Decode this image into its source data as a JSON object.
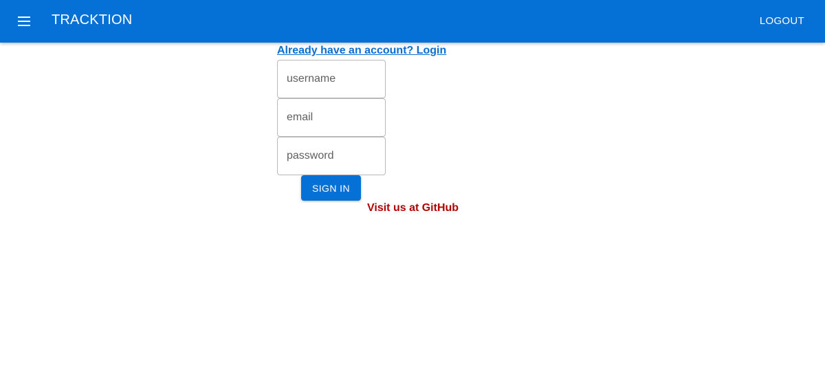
{
  "header": {
    "menu_icon": "hamburger-menu-icon",
    "title": "TRACKTION",
    "logout_label": "LOGOUT",
    "bg_color": "#0570d6"
  },
  "form": {
    "login_link": "Already have an account? Login",
    "username_placeholder": "username",
    "email_placeholder": "email",
    "password_placeholder": "password",
    "signin_label": "SIGN IN"
  },
  "footer": {
    "github_link": "Visit us at GitHub",
    "github_color": "#b00000"
  }
}
